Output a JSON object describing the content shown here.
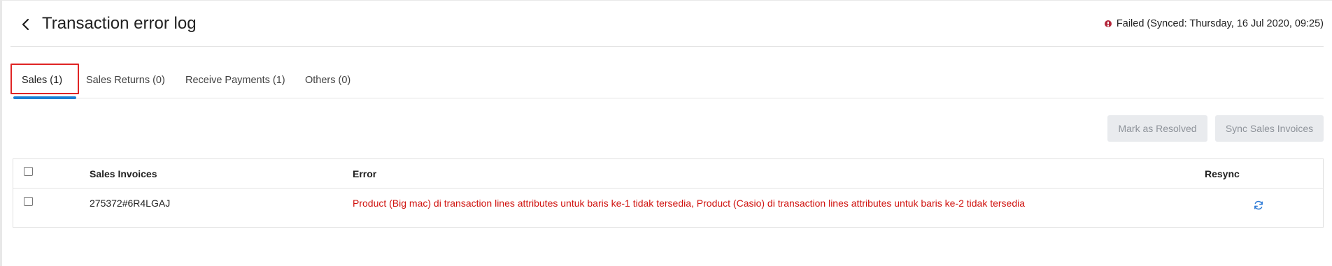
{
  "header": {
    "title": "Transaction error log",
    "status_text": "Failed (Synced: Thursday, 16 Jul 2020, 09:25)"
  },
  "tabs": [
    {
      "label": "Sales (1)",
      "active": true
    },
    {
      "label": "Sales Returns (0)",
      "active": false
    },
    {
      "label": "Receive Payments (1)",
      "active": false
    },
    {
      "label": "Others (0)",
      "active": false
    }
  ],
  "actions": {
    "mark_resolved": "Mark as Resolved",
    "sync_invoices": "Sync Sales Invoices"
  },
  "table": {
    "columns": [
      "Sales Invoices",
      "Error",
      "Resync"
    ],
    "rows": [
      {
        "invoice": "275372#6R4LGAJ",
        "error": "Product (Big mac) di transaction lines attributes untuk baris ke-1 tidak tersedia, Product (Casio) di transaction lines attributes untuk baris ke-2 tidak tersedia"
      }
    ]
  },
  "colors": {
    "accent": "#1a7fd4",
    "error_text": "#d0120e",
    "status_icon": "#b3263a",
    "highlight_box": "#e02424"
  },
  "icons": {
    "back": "chevron-left-icon",
    "status": "alert-circle-icon",
    "resync": "refresh-icon"
  }
}
